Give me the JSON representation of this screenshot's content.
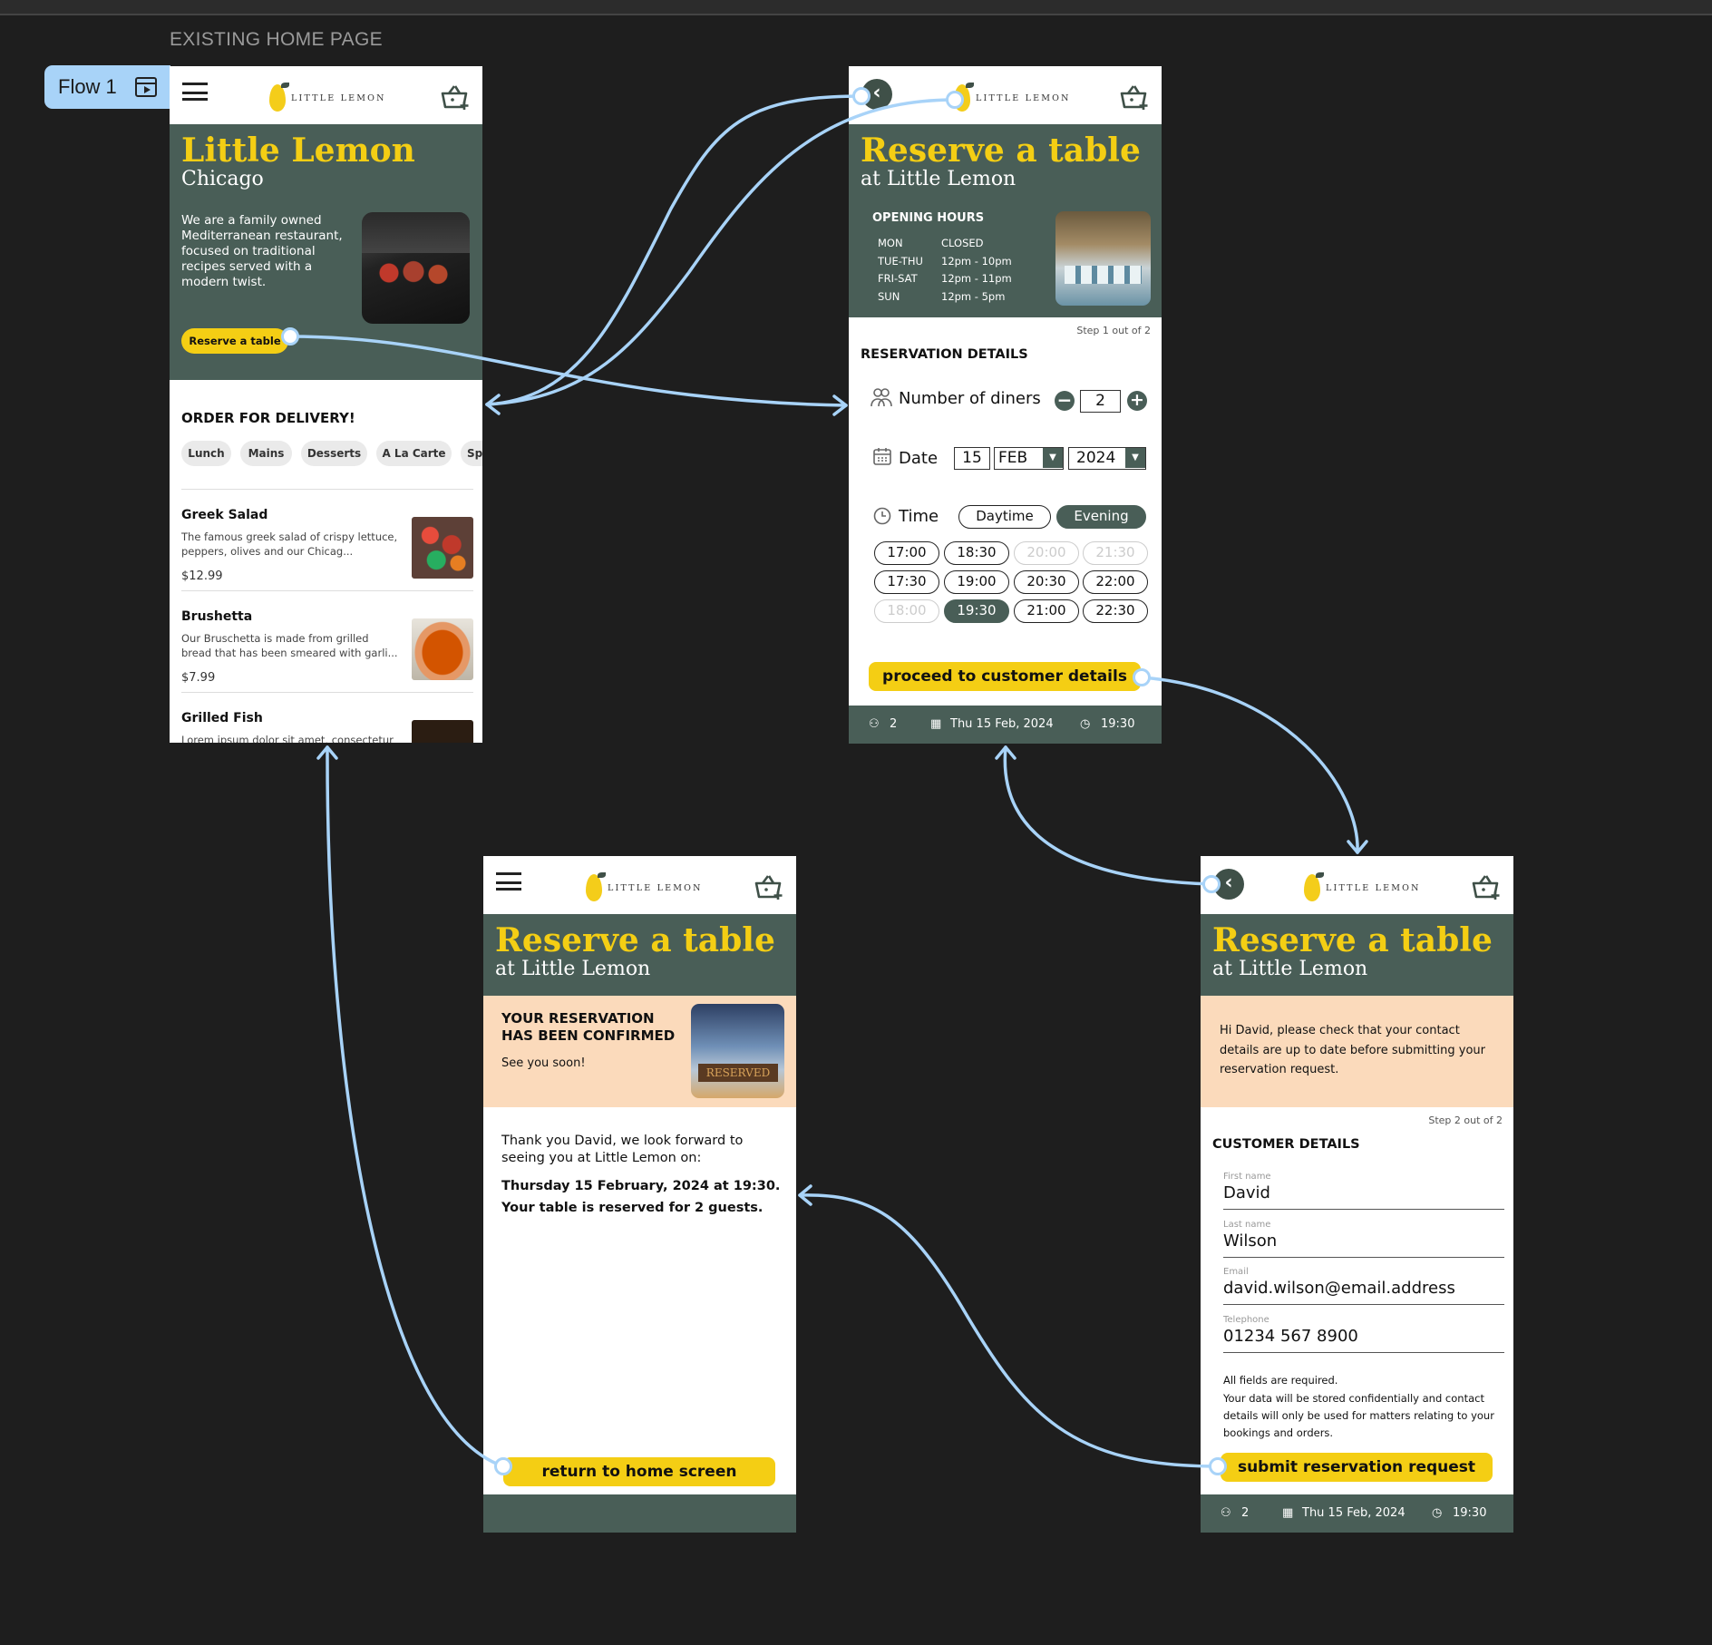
{
  "canvas": {
    "label": "EXISTING HOME PAGE",
    "flow_label": "Flow 1"
  },
  "brand": {
    "logo_text": "LITTLE LEMON",
    "accent": "#f4ce14",
    "green": "#495e57",
    "link_color": "#a8d3f8"
  },
  "home": {
    "title": "Little Lemon",
    "city": "Chicago",
    "description": "We are a family owned Mediterranean restaurant, focused on traditional recipes served with a modern twist.",
    "reserve_button": "Reserve a table",
    "delivery_heading": "ORDER FOR DELIVERY!",
    "categories": [
      "Lunch",
      "Mains",
      "Desserts",
      "A La Carte",
      "Spe"
    ],
    "items": [
      {
        "name": "Greek Salad",
        "desc": "The famous greek salad of crispy lettuce, peppers, olives and our Chicag...",
        "price": "$12.99"
      },
      {
        "name": "Brushetta",
        "desc": "Our Bruschetta is made from grilled bread that has been smeared with garli...",
        "price": "$7.99"
      },
      {
        "name": "Grilled Fish",
        "desc": "Lorem ipsum dolor sit amet, consectetur",
        "price": ""
      }
    ]
  },
  "step1": {
    "title": "Reserve a table",
    "subtitle": "at Little Lemon",
    "hours_heading": "OPENING HOURS",
    "hours": [
      {
        "days": "MON",
        "time": "CLOSED"
      },
      {
        "days": "TUE-THU",
        "time": "12pm - 10pm"
      },
      {
        "days": "FRI-SAT",
        "time": "12pm - 11pm"
      },
      {
        "days": "SUN",
        "time": "12pm - 5pm"
      }
    ],
    "step": "Step 1 out of 2",
    "section": "RESERVATION DETAILS",
    "diners_label": "Number of diners",
    "diners": "2",
    "date_label": "Date",
    "day": "15",
    "month": "FEB",
    "year": "2024",
    "time_label": "Time",
    "daytime": "Daytime",
    "evening": "Evening",
    "slots": [
      "17:00",
      "18:30",
      "20:00",
      "21:30",
      "17:30",
      "19:00",
      "20:30",
      "22:00",
      "18:00",
      "19:30",
      "21:00",
      "22:30"
    ],
    "proceed": "proceed to customer details"
  },
  "summary": {
    "diners": "2",
    "date": "Thu 15 Feb, 2024",
    "time": "19:30"
  },
  "confirm": {
    "title": "Reserve a table",
    "subtitle": "at Little Lemon",
    "heading_line1": "YOUR RESERVATION",
    "heading_line2": "HAS BEEN CONFIRMED",
    "see_you": "See you soon!",
    "reserved_sign": "RESERVED",
    "thanks": "Thank you David,  we look forward to seeing you at Little Lemon on:",
    "when": "Thursday 15 February, 2024 at 19:30.",
    "guests": "Your table is reserved for 2 guests.",
    "return_button": "return to home screen"
  },
  "step2": {
    "title": "Reserve a table",
    "subtitle": "at Little Lemon",
    "intro": "Hi David, please check that your contact details are up to date before submitting your reservation request.",
    "step": "Step 2 out of 2",
    "section": "CUSTOMER DETAILS",
    "fields": [
      {
        "label": "First name",
        "value": "David"
      },
      {
        "label": "Last name",
        "value": "Wilson"
      },
      {
        "label": "Email",
        "value": "david.wilson@email.address"
      },
      {
        "label": "Telephone",
        "value": "01234 567 8900"
      }
    ],
    "note1": "All fields are required.",
    "note2": "Your data will be stored confidentially and contact details will only be used for matters relating to your bookings and orders.",
    "submit": "submit reservation request"
  }
}
